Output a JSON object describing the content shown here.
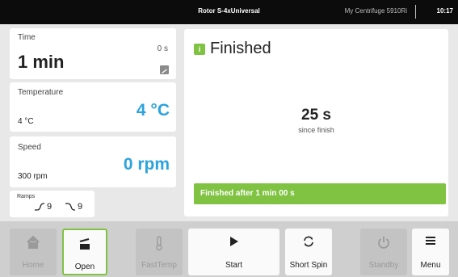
{
  "statusbar": {
    "rotor": "Rotor S-4xUniversal",
    "device": "My Centrifuge 5910Ri",
    "clock": "10:17"
  },
  "time": {
    "label": "Time",
    "value": "1 min",
    "remaining": "0 s"
  },
  "temperature": {
    "label": "Temperature",
    "set_value": "4 °C",
    "actual_value": "4 °C"
  },
  "speed": {
    "label": "Speed",
    "set_value": "300 rpm",
    "actual_value": "0 rpm"
  },
  "ramps": {
    "label": "Ramps",
    "accel": "9",
    "decel": "9"
  },
  "status": {
    "title": "Finished",
    "elapsed": "25 s",
    "elapsed_label": "since finish",
    "message": "Finished after 1 min 00 s"
  },
  "toolbar": {
    "home": "Home",
    "open": "Open",
    "fasttemp": "FastTemp",
    "start": "Start",
    "short_spin": "Short Spin",
    "standby": "Standby",
    "menu": "Menu"
  },
  "icons": {
    "info": "info-icon",
    "home": "home-icon",
    "open": "lid-open-icon",
    "fasttemp": "thermometer-icon",
    "start": "play-icon",
    "short_spin": "refresh-icon",
    "standby": "power-icon",
    "menu": "hamburger-icon"
  },
  "colors": {
    "accent_blue": "#2ba3dc",
    "status_green": "#80c242",
    "topbar": "#0c0c0c"
  }
}
